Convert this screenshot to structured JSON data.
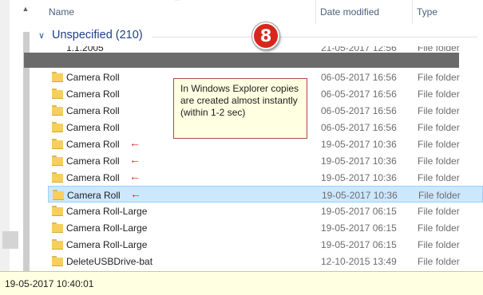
{
  "columns": {
    "name": "Name",
    "date_modified": "Date modified",
    "type": "Type"
  },
  "group": {
    "label": "Unspecified (210)"
  },
  "step_badge": "8",
  "partial_row": {
    "name": "1.1.2005",
    "date": "21-05-2017 12:56",
    "type": "File folder"
  },
  "rows": [
    {
      "name": "Camera Roll",
      "date": "06-05-2017 16:56",
      "type": "File folder",
      "arrow": false,
      "selected": false
    },
    {
      "name": "Camera Roll",
      "date": "06-05-2017 16:56",
      "type": "File folder",
      "arrow": false,
      "selected": false
    },
    {
      "name": "Camera Roll",
      "date": "06-05-2017 16:56",
      "type": "File folder",
      "arrow": false,
      "selected": false
    },
    {
      "name": "Camera Roll",
      "date": "06-05-2017 16:56",
      "type": "File folder",
      "arrow": false,
      "selected": false
    },
    {
      "name": "Camera Roll",
      "date": "19-05-2017 10:36",
      "type": "File folder",
      "arrow": true,
      "selected": false
    },
    {
      "name": "Camera Roll",
      "date": "19-05-2017 10:36",
      "type": "File folder",
      "arrow": true,
      "selected": false
    },
    {
      "name": "Camera Roll",
      "date": "19-05-2017 10:36",
      "type": "File folder",
      "arrow": true,
      "selected": false
    },
    {
      "name": "Camera Roll",
      "date": "19-05-2017 10:36",
      "type": "File folder",
      "arrow": true,
      "selected": true
    },
    {
      "name": "Camera Roll-Large",
      "date": "19-05-2017 06:15",
      "type": "File folder",
      "arrow": false,
      "selected": false
    },
    {
      "name": "Camera Roll-Large",
      "date": "19-05-2017 06:15",
      "type": "File folder",
      "arrow": false,
      "selected": false
    },
    {
      "name": "Camera Roll-Large",
      "date": "19-05-2017 06:15",
      "type": "File folder",
      "arrow": false,
      "selected": false
    },
    {
      "name": "DeleteUSBDrive-bat",
      "date": "12-10-2015 13:49",
      "type": "File folder",
      "arrow": false,
      "selected": false
    }
  ],
  "callout": {
    "text": "In Windows Explorer copies are created almost instantly (within 1-2 sec)"
  },
  "status": {
    "text": "19-05-2017 10:40:01"
  },
  "icons": {
    "folder": "folder-icon",
    "arrow": "left-arrow-icon",
    "chevron": "chevron-down-icon",
    "sort": "sort-ascending-icon"
  },
  "colors": {
    "selection": "#cce8ff",
    "callout_bg": "#ffffe1",
    "badge": "#d7271d",
    "arrow": "#e0201d"
  }
}
